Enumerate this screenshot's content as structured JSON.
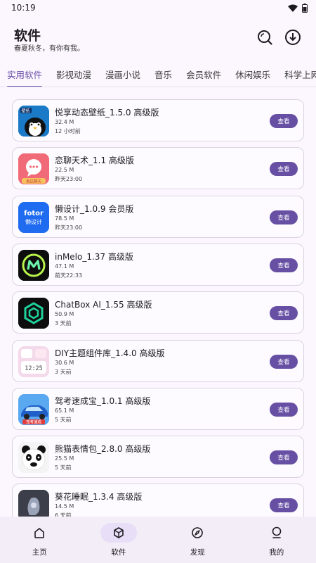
{
  "status": {
    "time": "10:19"
  },
  "header": {
    "title": "软件",
    "subtitle": "春夏秋冬，有你有我。"
  },
  "tabs": [
    "实用软件",
    "影视动漫",
    "漫画小说",
    "音乐",
    "会员软件",
    "休闲娱乐",
    "科学上网"
  ],
  "active_tab": 0,
  "apps": [
    {
      "name": "悦享动态壁纸_1.5.0 高级版",
      "size": "32.4 M",
      "time": "12 小时前",
      "icon": "penguin-wallpaper-icon",
      "color": "#1a7ac8"
    },
    {
      "name": "恋聊天术_1.1 高级版",
      "size": "22.5 M",
      "time": "昨天23:00",
      "icon": "chat-bubble-icon",
      "color": "#f06a78"
    },
    {
      "name": "懒设计_1.0.9 会员版",
      "size": "78.5 M",
      "time": "昨天23:00",
      "icon": "fotor-icon",
      "color": "#1f6cf0"
    },
    {
      "name": "inMelo_1.37 高级版",
      "size": "47.1 M",
      "time": "前天22:33",
      "icon": "inmelo-icon",
      "color": "#111111"
    },
    {
      "name": "ChatBox AI_1.55 高级版",
      "size": "50.9 M",
      "time": "3 天前",
      "icon": "chatbox-hexagon-icon",
      "color": "#111111"
    },
    {
      "name": "DIY主题组件库_1.4.0 高级版",
      "size": "30.6 M",
      "time": "3 天前",
      "icon": "widget-clock-icon",
      "color": "#f6d6e6"
    },
    {
      "name": "驾考速成宝_1.0.1 高级版",
      "size": "65.1 M",
      "time": "5 天前",
      "icon": "car-icon",
      "color": "#2a88e8"
    },
    {
      "name": "熊猫表情包_2.8.0 高级版",
      "size": "25.5 M",
      "time": "5 天前",
      "icon": "panda-meme-icon",
      "color": "#f4f4f4"
    },
    {
      "name": "葵花睡眠_1.3.4 高级版",
      "size": "14.5 M",
      "time": "6 天前",
      "icon": "sleep-icon",
      "color": "#3c3f4a"
    }
  ],
  "icon_texts": {
    "fotor_top": "fotor",
    "fotor_bottom": "懒设计",
    "wallpaper": "壁纸",
    "clock": "12:25",
    "chat_badge": "表达聊天",
    "car_badge": "驾考速成"
  },
  "view_label": "查看",
  "nav": [
    {
      "label": "主页",
      "icon": "home-icon"
    },
    {
      "label": "软件",
      "icon": "cube-icon"
    },
    {
      "label": "发现",
      "icon": "compass-icon"
    },
    {
      "label": "我的",
      "icon": "person-icon"
    }
  ],
  "active_nav": 1
}
